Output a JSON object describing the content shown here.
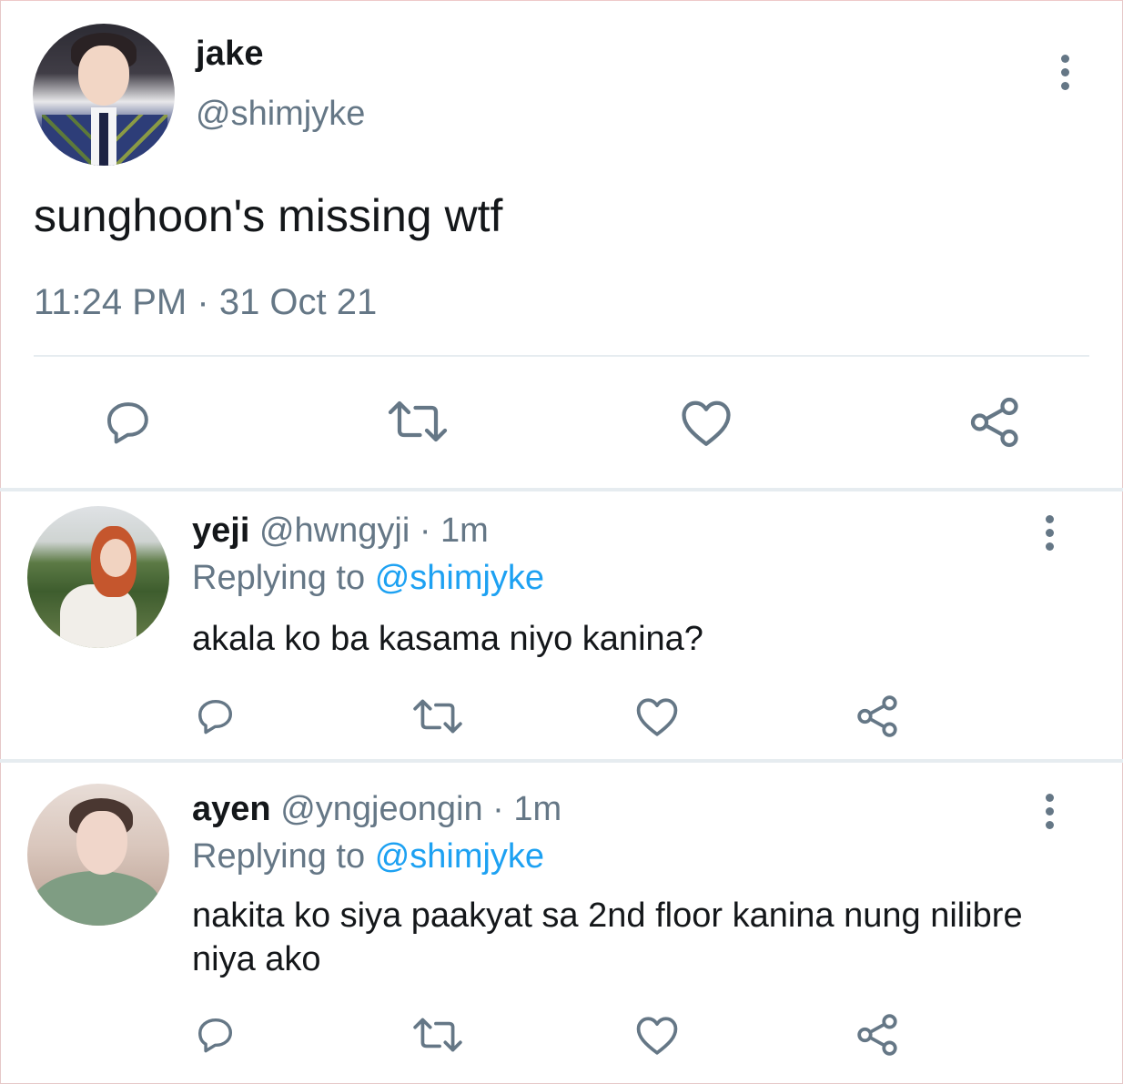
{
  "main_tweet": {
    "author_name": "jake",
    "author_handle": "@shimjyke",
    "text": "sunghoon's missing wtf",
    "time": "11:24 PM",
    "separator": "·",
    "date": "31 Oct 21",
    "actions": [
      "reply-icon",
      "retweet-icon",
      "like-icon",
      "share-icon"
    ]
  },
  "replies": [
    {
      "name": "yeji",
      "handle": "@hwngyji",
      "separator": "·",
      "age": "1m",
      "replying_prefix": "Replying to",
      "replying_to": "@shimjyke",
      "text": "akala ko ba kasama niyo kanina?"
    },
    {
      "name": "ayen",
      "handle": "@yngjeongin",
      "separator": "·",
      "age": "1m",
      "replying_prefix": "Replying to",
      "replying_to": "@shimjyke",
      "text": "nakita ko siya paakyat sa 2nd floor kanina nung nilibre niya ako"
    }
  ],
  "colors": {
    "text_primary": "#14171a",
    "text_secondary": "#657786",
    "mention": "#1da1f2",
    "divider": "#e6ecf0"
  }
}
